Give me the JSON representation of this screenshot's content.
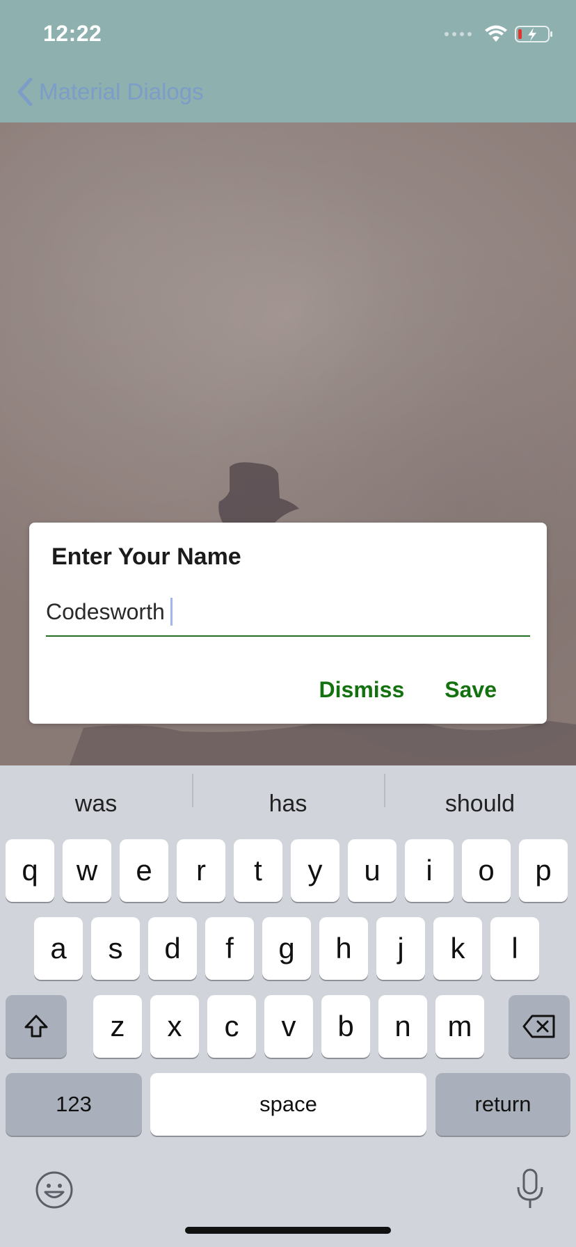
{
  "status_bar": {
    "time": "12:22"
  },
  "nav": {
    "back_label": "Material Dialogs"
  },
  "dialog": {
    "title": "Enter Your Name",
    "input_value": "Codesworth",
    "dismiss_label": "Dismiss",
    "save_label": "Save",
    "accent_color": "#13720f"
  },
  "keyboard": {
    "suggestions": [
      "was",
      "has",
      "should"
    ],
    "row1": [
      "q",
      "w",
      "e",
      "r",
      "t",
      "y",
      "u",
      "i",
      "o",
      "p"
    ],
    "row2": [
      "a",
      "s",
      "d",
      "f",
      "g",
      "h",
      "j",
      "k",
      "l"
    ],
    "row3": [
      "z",
      "x",
      "c",
      "v",
      "b",
      "n",
      "m"
    ],
    "numbers_label": "123",
    "space_label": "space",
    "return_label": "return"
  }
}
